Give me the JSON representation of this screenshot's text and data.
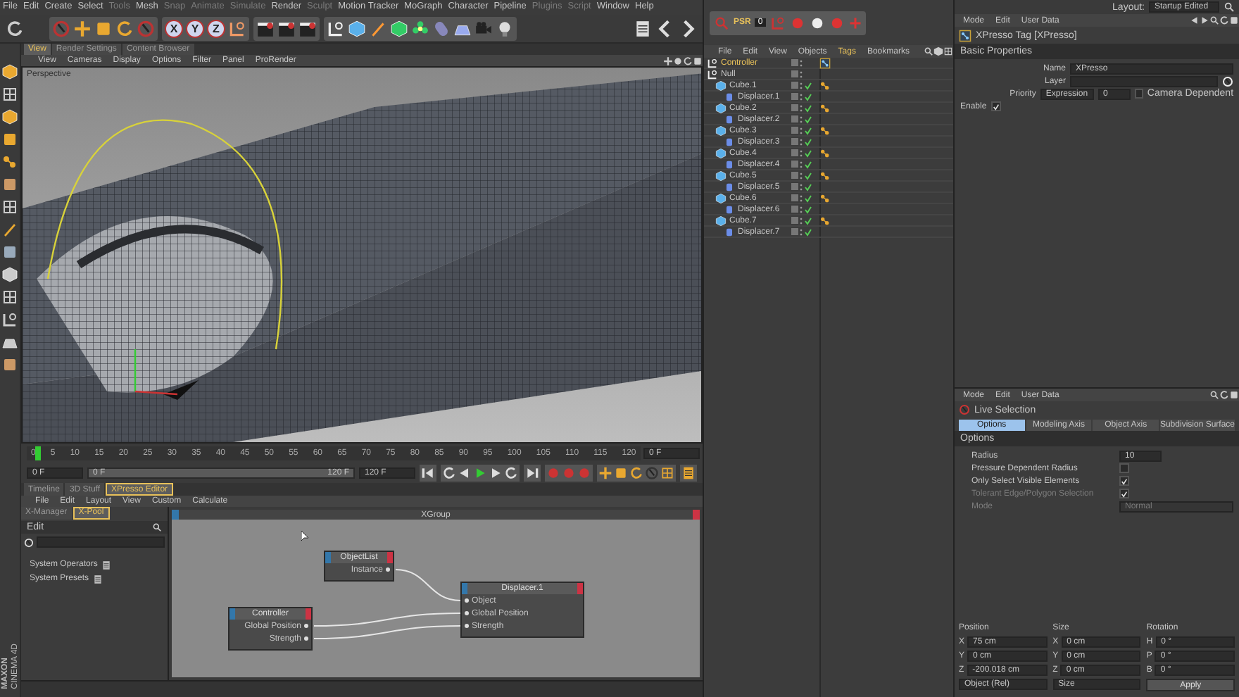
{
  "menu_bar": [
    {
      "label": "File",
      "disabled": false
    },
    {
      "label": "Edit",
      "disabled": false
    },
    {
      "label": "Create",
      "disabled": false
    },
    {
      "label": "Select",
      "disabled": false
    },
    {
      "label": "Tools",
      "disabled": true
    },
    {
      "label": "Mesh",
      "disabled": false
    },
    {
      "label": "Snap",
      "disabled": true
    },
    {
      "label": "Animate",
      "disabled": true
    },
    {
      "label": "Simulate",
      "disabled": true
    },
    {
      "label": "Render",
      "disabled": false
    },
    {
      "label": "Sculpt",
      "disabled": true
    },
    {
      "label": "Motion Tracker",
      "disabled": false
    },
    {
      "label": "MoGraph",
      "disabled": false
    },
    {
      "label": "Character",
      "disabled": false
    },
    {
      "label": "Pipeline",
      "disabled": false
    },
    {
      "label": "Plugins",
      "disabled": true
    },
    {
      "label": "Script",
      "disabled": true
    },
    {
      "label": "Window",
      "disabled": false
    },
    {
      "label": "Help",
      "disabled": false
    }
  ],
  "toolbar": {
    "axes": [
      "X",
      "Y",
      "Z"
    ]
  },
  "logo": {
    "brand": "MAXON",
    "product": "CINEMA 4D"
  },
  "viewport": {
    "tabs": [
      {
        "label": "View",
        "selected": true
      },
      {
        "label": "Render Settings",
        "selected": false
      },
      {
        "label": "Content Browser",
        "selected": false
      }
    ],
    "menu": [
      "View",
      "Cameras",
      "Display",
      "Options",
      "Filter",
      "Panel",
      "ProRender"
    ],
    "camera_label": "Perspective"
  },
  "timeline": {
    "ticks": [
      "0",
      "5",
      "10",
      "15",
      "20",
      "25",
      "30",
      "35",
      "40",
      "45",
      "50",
      "55",
      "60",
      "65",
      "70",
      "75",
      "80",
      "85",
      "90",
      "95",
      "100",
      "105",
      "110",
      "115",
      "120"
    ],
    "frame_field": "0 F",
    "start_field": "0 F",
    "range": {
      "level": 1
    },
    "range_start": "0 F",
    "range_end": "120 F",
    "end_field": "120 F"
  },
  "xpresso": {
    "tabs": [
      {
        "label": "Timeline",
        "selected": false
      },
      {
        "label": "3D Stuff",
        "selected": false
      },
      {
        "label": "XPresso Editor",
        "selected": true
      }
    ],
    "menu": [
      "File",
      "Edit",
      "Layout",
      "View",
      "Custom",
      "Calculate"
    ],
    "pool_tabs": [
      {
        "label": "X-Manager",
        "selected": false
      },
      {
        "label": "X-Pool",
        "selected": true
      }
    ],
    "pool_header": "Edit",
    "pool_items": [
      "System Operators",
      "System Presets"
    ],
    "group_title": "XGroup",
    "nodes": [
      {
        "title": "ObjectList",
        "outputs": [
          "Instance"
        ]
      },
      {
        "title": "Controller",
        "outputs": [
          "Global Position",
          "Strength"
        ]
      },
      {
        "title": "Displacer.1",
        "inputs": [
          "Object",
          "Global Position",
          "Strength"
        ]
      }
    ]
  },
  "object_manager": {
    "psr_label": "PSR",
    "psr_value": "0",
    "menu": [
      {
        "label": "File",
        "selected": false
      },
      {
        "label": "Edit",
        "selected": false
      },
      {
        "label": "View",
        "selected": false
      },
      {
        "label": "Objects",
        "selected": false
      },
      {
        "label": "Tags",
        "selected": true
      },
      {
        "label": "Bookmarks",
        "selected": false
      }
    ],
    "tree": [
      {
        "name": "Controller",
        "kind": "null",
        "selected": true,
        "enabled": false,
        "tag": {
          "kind": "xpresso"
        }
      },
      {
        "name": "Null",
        "kind": "null",
        "selected": false,
        "enabled": false,
        "children": [
          {
            "name": "Cube.1",
            "kind": "cube",
            "selected": false,
            "enabled": true,
            "tag": {
              "kind": "dots"
            },
            "children": [
              {
                "name": "Displacer.1",
                "kind": "deformer",
                "selected": false,
                "enabled": true
              }
            ]
          },
          {
            "name": "Cube.2",
            "kind": "cube",
            "selected": false,
            "enabled": true,
            "tag": {
              "kind": "dots"
            },
            "children": [
              {
                "name": "Displacer.2",
                "kind": "deformer",
                "selected": false,
                "enabled": true
              }
            ]
          },
          {
            "name": "Cube.3",
            "kind": "cube",
            "selected": false,
            "enabled": true,
            "tag": {
              "kind": "dots"
            },
            "children": [
              {
                "name": "Displacer.3",
                "kind": "deformer",
                "selected": false,
                "enabled": true
              }
            ]
          },
          {
            "name": "Cube.4",
            "kind": "cube",
            "selected": false,
            "enabled": true,
            "tag": {
              "kind": "dots"
            },
            "children": [
              {
                "name": "Displacer.4",
                "kind": "deformer",
                "selected": false,
                "enabled": true
              }
            ]
          },
          {
            "name": "Cube.5",
            "kind": "cube",
            "selected": false,
            "enabled": true,
            "tag": {
              "kind": "dots"
            },
            "children": [
              {
                "name": "Displacer.5",
                "kind": "deformer",
                "selected": false,
                "enabled": true
              }
            ]
          },
          {
            "name": "Cube.6",
            "kind": "cube",
            "selected": false,
            "enabled": true,
            "tag": {
              "kind": "dots"
            },
            "children": [
              {
                "name": "Displacer.6",
                "kind": "deformer",
                "selected": false,
                "enabled": true
              }
            ]
          },
          {
            "name": "Cube.7",
            "kind": "cube",
            "selected": false,
            "enabled": true,
            "tag": {
              "kind": "dots"
            },
            "children": [
              {
                "name": "Displacer.7",
                "kind": "deformer",
                "selected": false,
                "enabled": true
              }
            ]
          }
        ]
      }
    ]
  },
  "layout": {
    "label": "Layout:",
    "value": "Startup Edited"
  },
  "attributes": {
    "menu": [
      "Mode",
      "Edit",
      "User Data"
    ],
    "title": "XPresso Tag [XPresso]",
    "section": "Basic Properties",
    "fields": [
      {
        "kind": "text",
        "label": "Name",
        "value": "XPresso"
      },
      {
        "kind": "layer",
        "label": "Layer"
      },
      {
        "kind": "priority",
        "label": "Priority",
        "value": "Expression",
        "number": "0",
        "option_label": "Camera Dependent",
        "checked": false
      },
      {
        "kind": "check",
        "label": "Enable",
        "checked": true
      }
    ]
  },
  "tool_attributes": {
    "menu": [
      "Mode",
      "Edit",
      "User Data"
    ],
    "title": "Live Selection",
    "tabs": [
      {
        "label": "Options",
        "selected": true
      },
      {
        "label": "Modeling Axis",
        "selected": false
      },
      {
        "label": "Object Axis",
        "selected": false
      },
      {
        "label": "Subdivision Surface",
        "selected": false
      }
    ],
    "section": "Options",
    "fields": [
      {
        "kind": "number",
        "label": "Radius",
        "value": "10",
        "disabled": false
      },
      {
        "kind": "check",
        "label": "Pressure Dependent Radius",
        "checked": false,
        "disabled": false
      },
      {
        "kind": "check",
        "label": "Only Select Visible Elements",
        "checked": true,
        "disabled": false
      },
      {
        "kind": "check",
        "label": "Tolerant Edge/Polygon Selection",
        "checked": true,
        "disabled": true
      },
      {
        "kind": "dropdown",
        "label": "Mode",
        "value": "Normal",
        "disabled": true
      }
    ]
  },
  "coordinates": {
    "headers": [
      "Position",
      "Size",
      "Rotation"
    ],
    "rows": [
      [
        {
          "axis": "X",
          "value": "75 cm"
        },
        {
          "axis": "X",
          "value": "0 cm"
        },
        {
          "axis": "H",
          "value": "0 °"
        }
      ],
      [
        {
          "axis": "Y",
          "value": "0 cm"
        },
        {
          "axis": "Y",
          "value": "0 cm"
        },
        {
          "axis": "P",
          "value": "0 °"
        }
      ],
      [
        {
          "axis": "Z",
          "value": "-200.018 cm"
        },
        {
          "axis": "Z",
          "value": "0 cm"
        },
        {
          "axis": "B",
          "value": "0 °"
        }
      ]
    ],
    "dropdowns": [
      "Object (Rel)",
      "Size"
    ],
    "apply": "Apply"
  }
}
